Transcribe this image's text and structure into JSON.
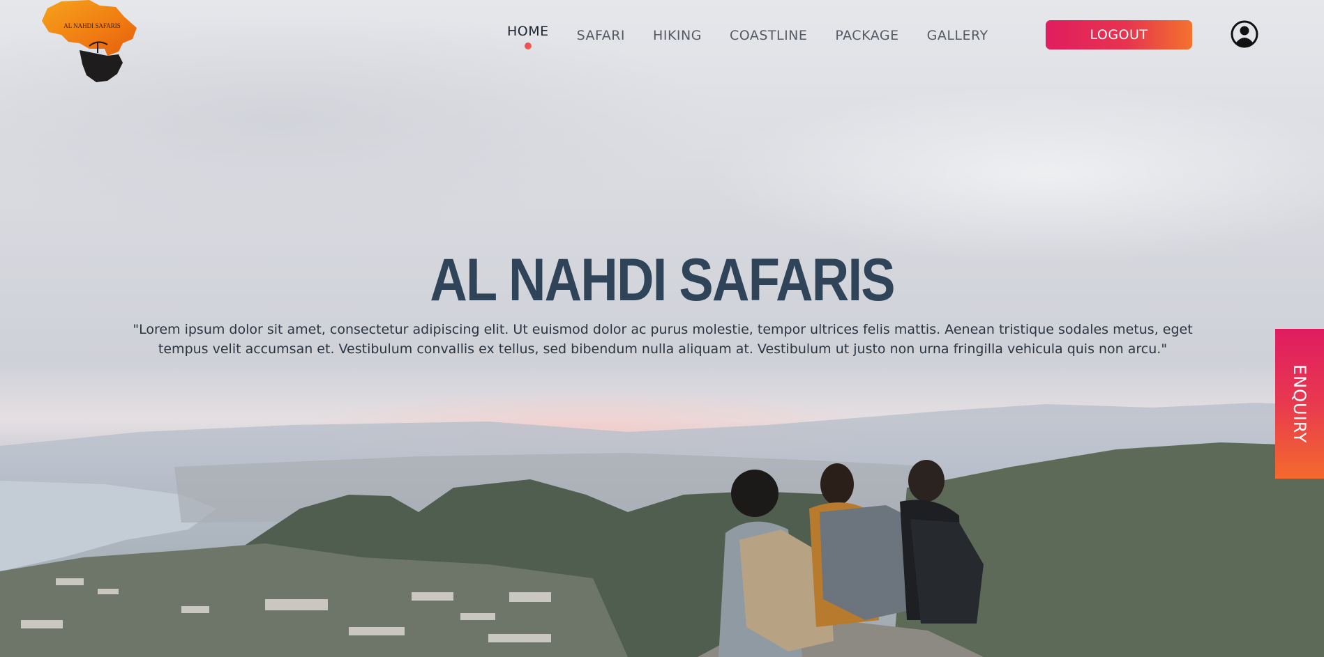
{
  "header": {
    "logo": {
      "icon": "africa-map-logo",
      "text": "AL NAHDI SAFARIS"
    },
    "nav": [
      {
        "label": "HOME",
        "active": true
      },
      {
        "label": "SAFARI",
        "active": false
      },
      {
        "label": "HIKING",
        "active": false
      },
      {
        "label": "COASTLINE",
        "active": false
      },
      {
        "label": "PACKAGE",
        "active": false
      },
      {
        "label": "GALLERY",
        "active": false
      }
    ],
    "logout_label": "LOGOUT",
    "profile_icon": "user-circle-icon"
  },
  "hero": {
    "title": "AL NAHDI SAFARIS",
    "description": "\"Lorem ipsum dolor sit amet, consectetur adipiscing elit. Ut euismod dolor ac purus molestie, tempor ultrices felis mattis. Aenean tristique sodales metus, eget tempus velit accumsan et. Vestibulum convallis ex tellus, sed bibendum nulla aliquam at. Vestibulum ut justo non urna fringilla vehicula quis non arcu.\"",
    "background": "hikers-overlooking-coastal-city"
  },
  "enquiry_label": "ENQUIRY",
  "colors": {
    "accent_start": "#e11d5f",
    "accent_end": "#f4722e",
    "title": "#2f4458",
    "text": "#2b3440"
  }
}
